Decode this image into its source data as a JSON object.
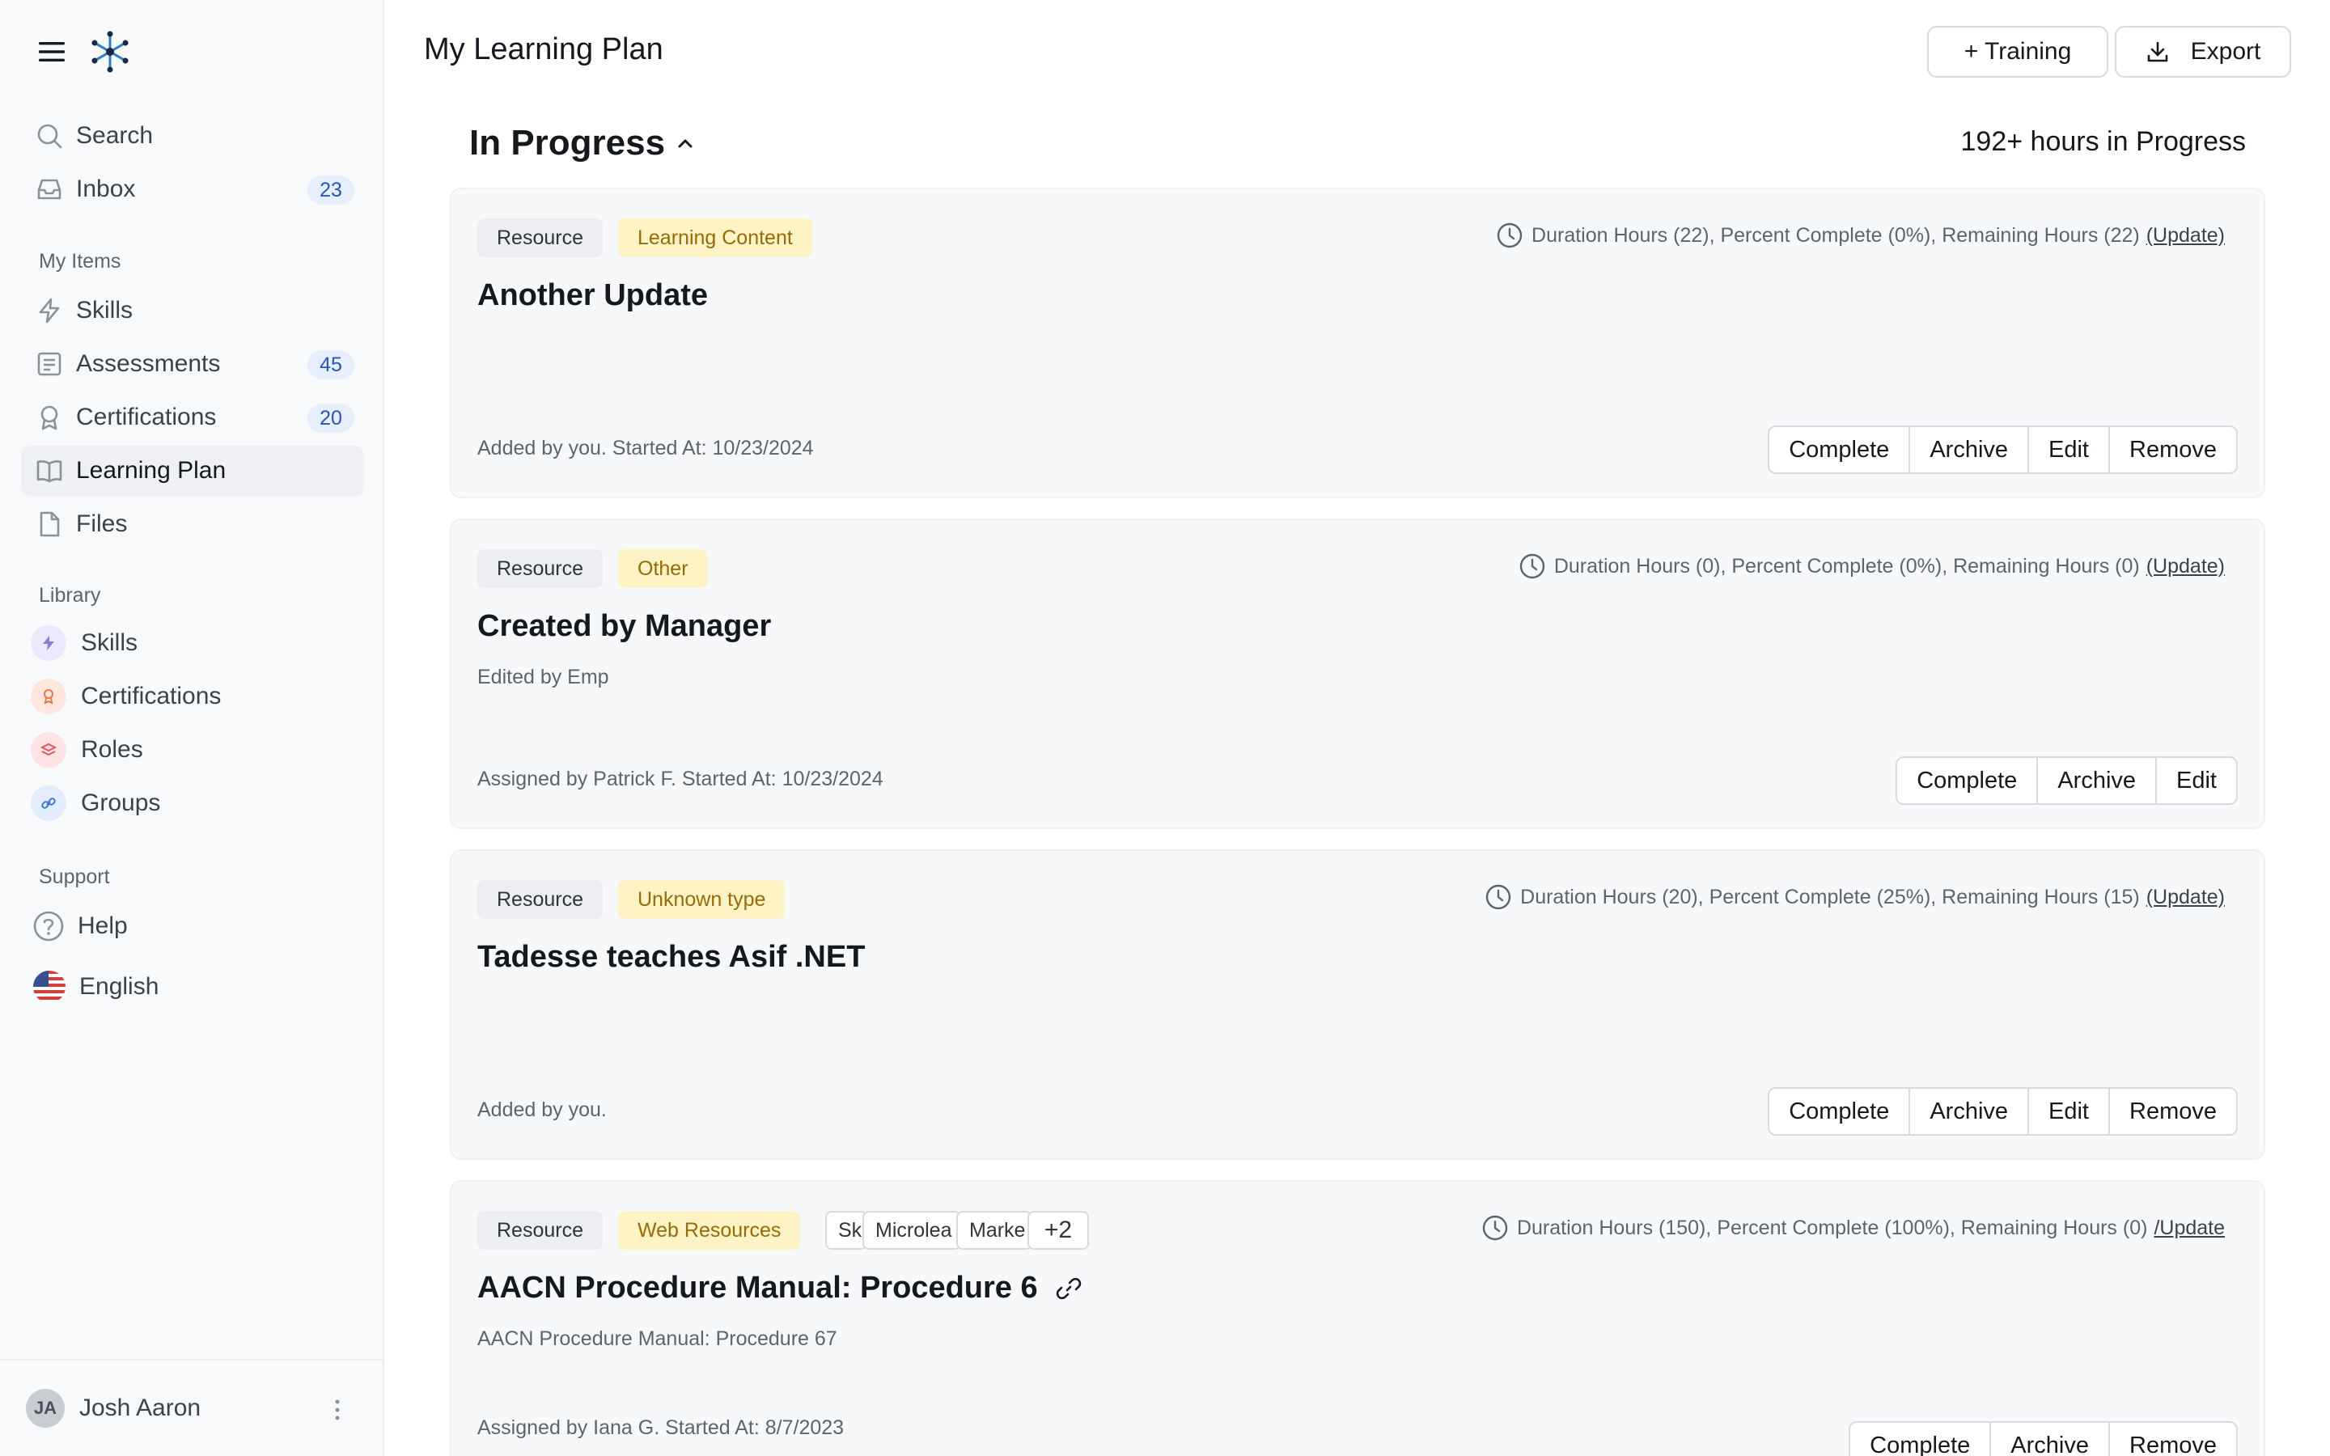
{
  "sidebar": {
    "search": "Search",
    "inbox": {
      "label": "Inbox",
      "count": "23"
    },
    "my_items_label": "My Items",
    "my_items": [
      {
        "label": "Skills",
        "icon": "lightning-icon",
        "count": null
      },
      {
        "label": "Assessments",
        "icon": "clipboard-icon",
        "count": "45"
      },
      {
        "label": "Certifications",
        "icon": "ribbon-icon",
        "count": "20"
      },
      {
        "label": "Learning Plan",
        "icon": "book-icon",
        "count": null,
        "active": true
      },
      {
        "label": "Files",
        "icon": "file-icon",
        "count": null
      }
    ],
    "library_label": "Library",
    "library": [
      {
        "label": "Skills",
        "icon": "lightning-icon",
        "color": "#ece8fb"
      },
      {
        "label": "Certifications",
        "icon": "ribbon-icon",
        "color": "#fde7dc"
      },
      {
        "label": "Roles",
        "icon": "layers-icon",
        "color": "#fde3e3"
      },
      {
        "label": "Groups",
        "icon": "link-icon",
        "color": "#e3ecfc"
      }
    ],
    "support_label": "Support",
    "help": "Help",
    "language": "English",
    "user": {
      "initials": "JA",
      "name": "Josh Aaron"
    }
  },
  "header": {
    "title": "My Learning Plan",
    "training_button": "+ Training",
    "export_button": "Export"
  },
  "section": {
    "title": "In Progress",
    "hours_summary": "192+ hours in Progress"
  },
  "cards": [
    {
      "type_tag": "Resource",
      "category_tag": "Learning Content",
      "meta": "Duration Hours (22), Percent Complete (0%), Remaining Hours (22)",
      "update_link": "(Update)",
      "title": "Another Update",
      "subtitle": "",
      "footer": "Added by you. Started At: 10/23/2024",
      "actions": [
        "Complete",
        "Archive",
        "Edit",
        "Remove"
      ]
    },
    {
      "type_tag": "Resource",
      "category_tag": "Other",
      "meta": "Duration Hours (0), Percent Complete (0%), Remaining Hours (0)",
      "update_link": "(Update)",
      "title": "Created by Manager",
      "subtitle": "Edited by Emp",
      "footer": "Assigned by Patrick F. Started At: 10/23/2024",
      "actions": [
        "Complete",
        "Archive",
        "Edit"
      ]
    },
    {
      "type_tag": "Resource",
      "category_tag": "Unknown type",
      "meta": "Duration Hours (20), Percent Complete (25%), Remaining Hours (15)",
      "update_link": "(Update)",
      "title": "Tadesse teaches Asif .NET",
      "subtitle": "",
      "footer": "Added by you.",
      "actions": [
        "Complete",
        "Archive",
        "Edit",
        "Remove"
      ]
    },
    {
      "type_tag": "Resource",
      "category_tag": "Web Resources",
      "skills": [
        "Sk",
        "Microlea",
        "Marke",
        "+2"
      ],
      "meta": "Duration Hours (150), Percent Complete (100%), Remaining Hours (0)",
      "update_link": "/Update",
      "title": "AACN Procedure Manual: Procedure 6",
      "subtitle": "AACN Procedure Manual: Procedure 67",
      "footer": "Assigned by Iana G. Started At: 8/7/2023",
      "actions": [
        "Complete",
        "Archive",
        "Remove"
      ]
    }
  ]
}
